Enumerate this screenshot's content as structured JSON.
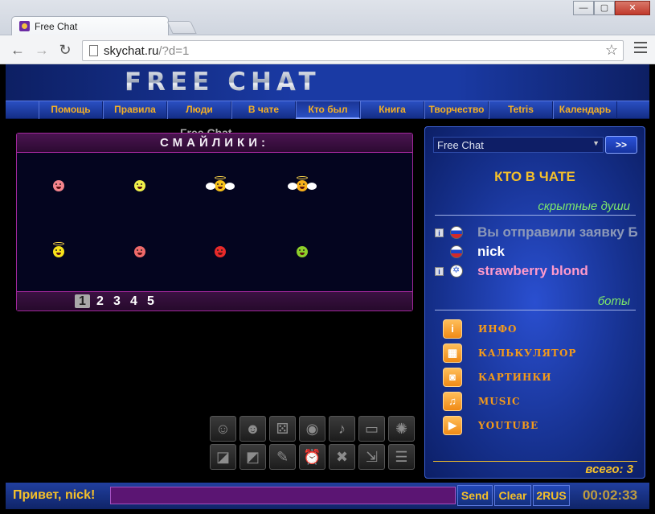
{
  "browser": {
    "tab_title": "Free Chat",
    "url_host": "skychat.ru",
    "url_path": "/?d=1",
    "window_buttons": [
      "—",
      "▢",
      "✕"
    ]
  },
  "site": {
    "logo_text": "FREE CHAT",
    "nav": [
      "Помощь",
      "Правила",
      "Люди",
      "В чате",
      "Кто был",
      "Книга",
      "Творчество",
      "Tetris",
      "Календарь"
    ],
    "active_nav": "Кто был"
  },
  "chat": {
    "ghost_title": "Free Chat",
    "smiley_header": "СМАЙЛИКИ:",
    "pages": [
      "1",
      "2",
      "3",
      "4",
      "5"
    ],
    "active_page": "1",
    "smileys": [
      {
        "kind": "scream",
        "color": "#f4848c"
      },
      {
        "kind": "shock",
        "color": "#f0f04a"
      },
      {
        "kind": "angel-wings",
        "color": "#f8c21a"
      },
      {
        "kind": "angel-wings",
        "color": "#f8b01a"
      },
      {
        "kind": "halo",
        "color": "#f8e21a"
      },
      {
        "kind": "sad",
        "color": "#ef6a6a"
      },
      {
        "kind": "angry",
        "color": "#e82a2a"
      },
      {
        "kind": "apple",
        "color": "#8ecf2a"
      }
    ],
    "tools": [
      {
        "icon": "smile-icon",
        "glyph": "☺"
      },
      {
        "icon": "smile-heart-icon",
        "glyph": "☻"
      },
      {
        "icon": "dice-icon",
        "glyph": "⚄"
      },
      {
        "icon": "webcam-icon",
        "glyph": "◉"
      },
      {
        "icon": "sound-icon",
        "glyph": "♪"
      },
      {
        "icon": "speech-bubble-icon",
        "glyph": "▭"
      },
      {
        "icon": "settings-gear-icon",
        "glyph": "✺"
      },
      {
        "icon": "chat-bubble-icon",
        "glyph": "◪"
      },
      {
        "icon": "chat-bubbles-icon",
        "glyph": "◩"
      },
      {
        "icon": "edit-pen-icon",
        "glyph": "✎"
      },
      {
        "icon": "alarm-clock-icon",
        "glyph": "⏰"
      },
      {
        "icon": "tools-icon",
        "glyph": "✖"
      },
      {
        "icon": "exit-icon",
        "glyph": "⇲"
      },
      {
        "icon": "notepad-icon",
        "glyph": "☰"
      }
    ]
  },
  "sidebar": {
    "room": "Free Chat",
    "go_label": ">>",
    "in_chat_title": "КТО В ЧАТЕ",
    "hidden_label": "скрытные души",
    "users": [
      {
        "name": "Вы отправили заявку Б",
        "info": true,
        "flag": "ru",
        "style": "pending"
      },
      {
        "name": "nick",
        "info": false,
        "flag": "ru",
        "style": "normal"
      },
      {
        "name": "strawberry blond",
        "info": true,
        "flag": "il",
        "style": "pink"
      }
    ],
    "bots_label": "боты",
    "bots": [
      {
        "label": "ИНФО",
        "icon": "info-icon",
        "glyph": "i"
      },
      {
        "label": "КАЛЬКУЛЯТОР",
        "icon": "calculator-icon",
        "glyph": "▦"
      },
      {
        "label": "КАРТИНКИ",
        "icon": "camera-icon",
        "glyph": "◙"
      },
      {
        "label": "MUSIC",
        "icon": "music-icon",
        "glyph": "♫"
      },
      {
        "label": "YOUTUBE",
        "icon": "video-icon",
        "glyph": "▶"
      }
    ],
    "total": "всего: 3"
  },
  "input_bar": {
    "greeting": "Привет, nick!",
    "message_value": "",
    "send": "Send",
    "clear": "Clear",
    "lang": "2RUS",
    "timer": "00:02:33"
  },
  "colors": {
    "accent_gold": "#f5c02a",
    "panel_blue": "#1a3aa4",
    "smiley_border": "#a1279b"
  }
}
